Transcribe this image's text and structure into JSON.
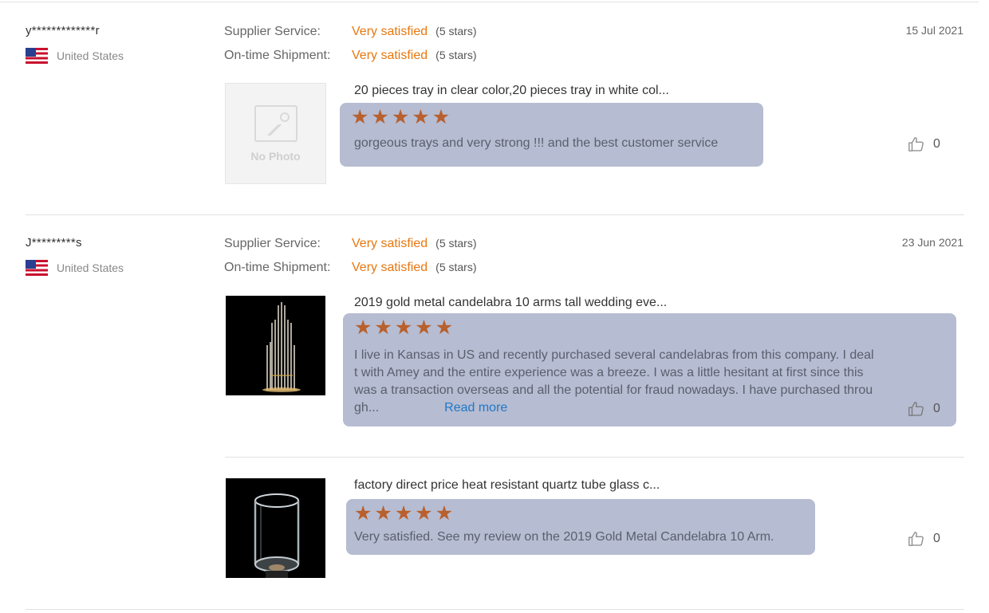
{
  "reviews": [
    {
      "user": "y*************r",
      "country": "United States",
      "date": "15 Jul 2021",
      "ratings": [
        {
          "label": "Supplier Service:",
          "value": "Very satisfied",
          "stars": "(5 stars)"
        },
        {
          "label": "On-time Shipment:",
          "value": "Very satisfied",
          "stars": "(5 stars)"
        }
      ],
      "items": [
        {
          "product": "20 pieces tray in clear color,20 pieces tray in white col...",
          "image": "No Photo",
          "rating": 5,
          "text": "gorgeous  trays and very strong  !!! and the best customer service",
          "likes": "0"
        }
      ]
    },
    {
      "user": "J*********s",
      "country": "United States",
      "date": "23 Jun 2021",
      "ratings": [
        {
          "label": "Supplier Service:",
          "value": "Very satisfied",
          "stars": "(5 stars)"
        },
        {
          "label": "On-time Shipment:",
          "value": "Very satisfied",
          "stars": "(5 stars)"
        }
      ],
      "items": [
        {
          "product": "2019 gold metal candelabra 10 arms tall wedding eve...",
          "rating": 5,
          "text_lines": [
            "I live in Kansas in US and recently purchased several candelabras from this company. I deal",
            "t with Amey and the entire experience was a breeze. I was a little hesitant at first since this",
            "was a transaction overseas and all the potential for fraud nowadays. I have purchased throu",
            "gh..."
          ],
          "read_more": "Read more",
          "likes": "0"
        },
        {
          "product": "factory direct price heat resistant quartz tube glass c...",
          "rating": 5,
          "text": "Very satisfied. See my review on the 2019 Gold Metal Candelabra 10 Arm.",
          "likes": "0"
        }
      ]
    }
  ],
  "colors": {
    "accent": "#e8770e",
    "bubble": "#b6bcd1",
    "star": "#b8602e",
    "link": "#1f78c8"
  },
  "icons": [
    "flag-us-icon",
    "no-photo-icon",
    "star-icon",
    "thumbs-up-icon"
  ]
}
